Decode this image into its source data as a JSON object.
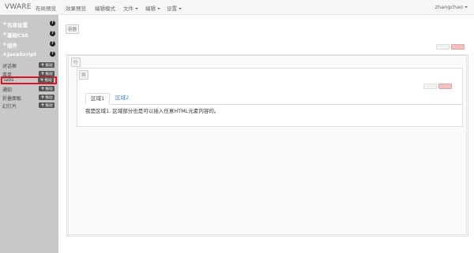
{
  "navbar": {
    "brand": "VWARE",
    "items": [
      "布局预览",
      "效果预览",
      "编辑模式",
      "文件",
      "编辑",
      "设置"
    ],
    "user": "zhangchao"
  },
  "sidebar": {
    "sections": [
      {
        "label": "布局设置",
        "help": "?"
      },
      {
        "label": "基础CSS",
        "help": "?"
      },
      {
        "label": "组件",
        "help": "?"
      },
      {
        "label": "JavaScript",
        "help": "?"
      }
    ],
    "components": [
      {
        "label": "对话框",
        "drag": "拖动"
      },
      {
        "label": "菜单",
        "drag": "拖动"
      },
      {
        "label": "Tabs",
        "drag": "拖动",
        "selected": true
      },
      {
        "label": "通知",
        "drag": "拖动"
      },
      {
        "label": "折叠面板",
        "drag": "拖动"
      },
      {
        "label": "幻灯片",
        "drag": "拖动"
      }
    ]
  },
  "canvas": {
    "container_tag": "容器",
    "row_tag": "行",
    "column_tag": "列",
    "tabs": [
      {
        "label": "区域1",
        "active": true
      },
      {
        "label": "区域2",
        "active": false
      }
    ],
    "tab_content": "我是区域1. 区域部分也是可以插入任意HTML元素内容的。"
  },
  "colors": {
    "sidebar_bg": "#c8c8c8",
    "highlight": "#e0141e",
    "link": "#3b82c4"
  }
}
